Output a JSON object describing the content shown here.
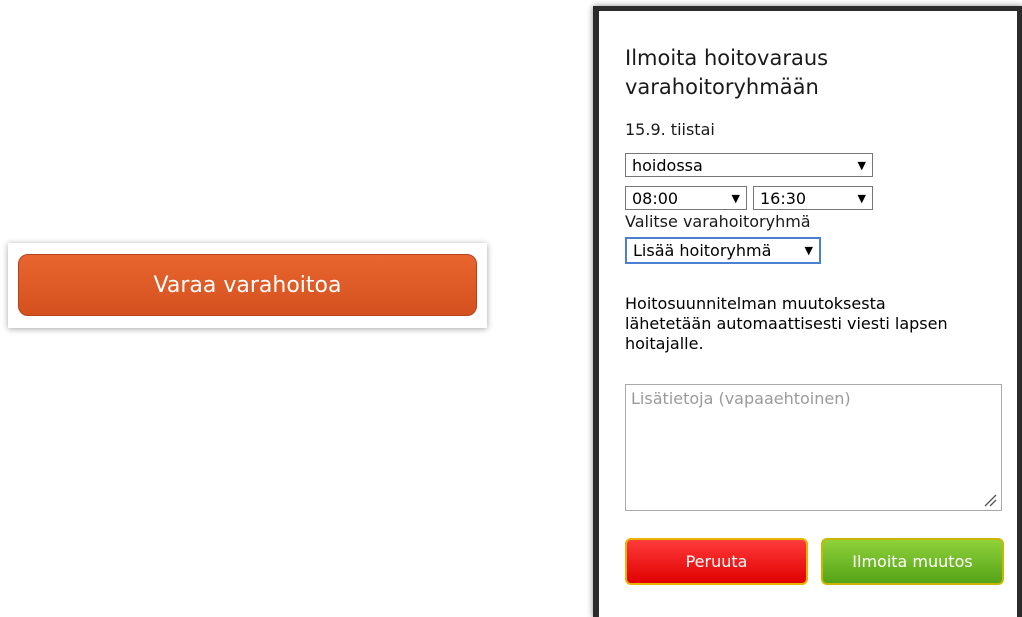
{
  "reserve": {
    "button_label": "Varaa varahoitoa"
  },
  "dialog": {
    "title": "Ilmoita hoitovaraus varahoitoryhmään",
    "date": "15.9. tiistai",
    "status_select": {
      "value": "hoidossa"
    },
    "start_time_select": {
      "value": "08:00"
    },
    "end_time_select": {
      "value": "16:30"
    },
    "group_label": "Valitse varahoitoryhmä",
    "group_select": {
      "value": "Lisää hoitoryhmä"
    },
    "notice": "Hoitosuunnitelman muutoksesta lähetetään automaattisesti viesti lapsen hoitajalle.",
    "notes_placeholder": "Lisätietoja (vapaaehtoinen)",
    "cancel_label": "Peruuta",
    "submit_label": "Ilmoita muutos"
  },
  "colors": {
    "reserve_button": "#e05a25",
    "cancel_button": "#f01818",
    "submit_button": "#6cbb25",
    "focus_border": "#4a7fd1"
  },
  "icons": {
    "dropdown": "triangle-down",
    "resize": "resize-grip"
  }
}
